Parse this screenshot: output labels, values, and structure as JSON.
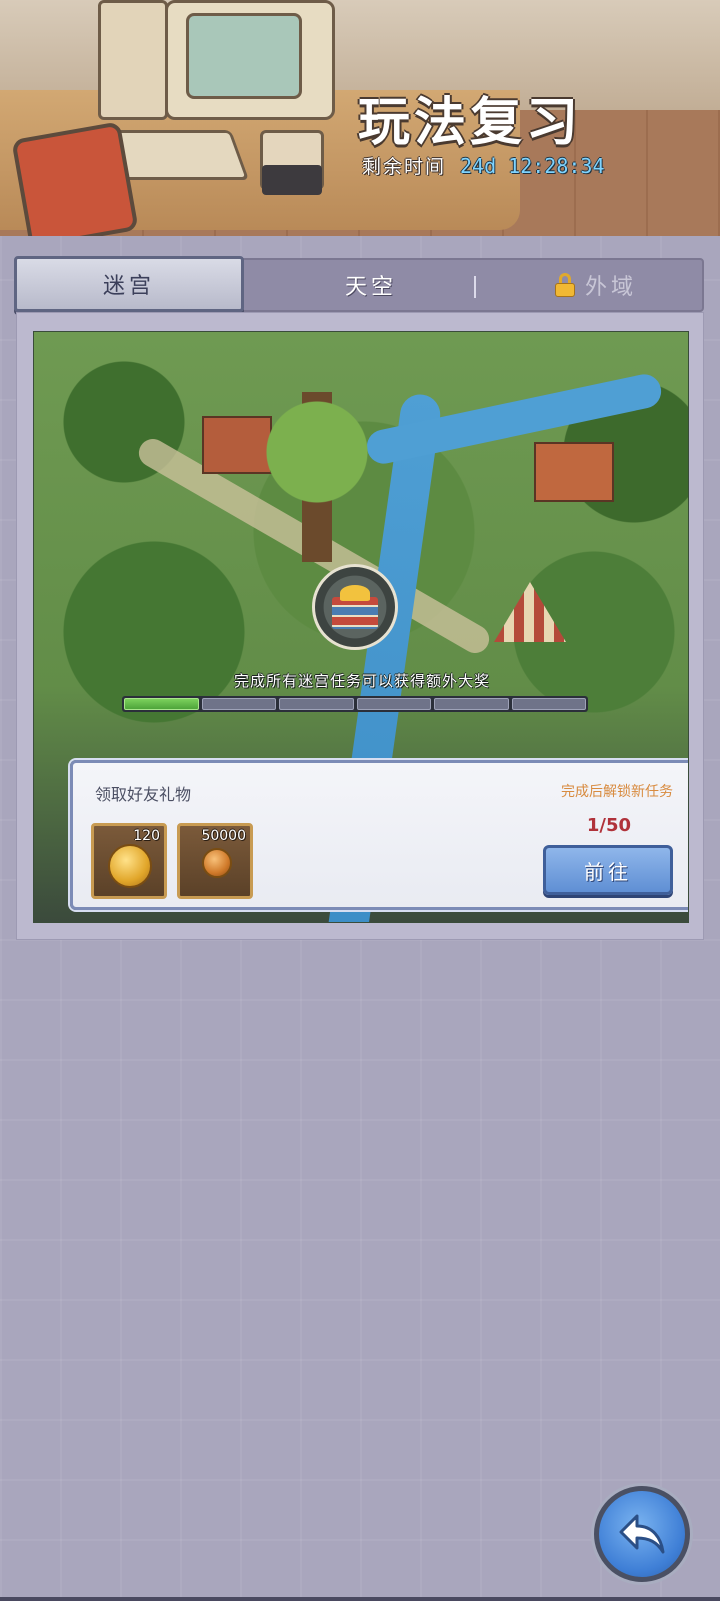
{
  "header": {
    "title": "玩法复习",
    "timer_label": "剩余时间",
    "timer_value": "24d 12:28:34"
  },
  "tabs": [
    {
      "label": "迷宫",
      "active": true,
      "locked": false
    },
    {
      "label": "天空",
      "active": false,
      "locked": false
    },
    {
      "label": "外域",
      "active": false,
      "locked": true
    }
  ],
  "map": {
    "caption": "完成所有迷宫任务可以获得额外大奖",
    "progress_segments_total": 6,
    "progress_segments_done": 1
  },
  "task": {
    "name": "领取好友礼物",
    "unlock_note": "完成后解锁新任务",
    "progress": "1/50",
    "go_label": "前往",
    "rewards": [
      {
        "icon": "gold-coin-icon",
        "count": "120"
      },
      {
        "icon": "copper-coin-icon",
        "count": "50000"
      }
    ]
  },
  "colors": {
    "accent_blue": "#5f8fd4",
    "progress_green": "#4ea43a",
    "note_orange": "#d88b3f",
    "progress_red": "#b0323a"
  }
}
